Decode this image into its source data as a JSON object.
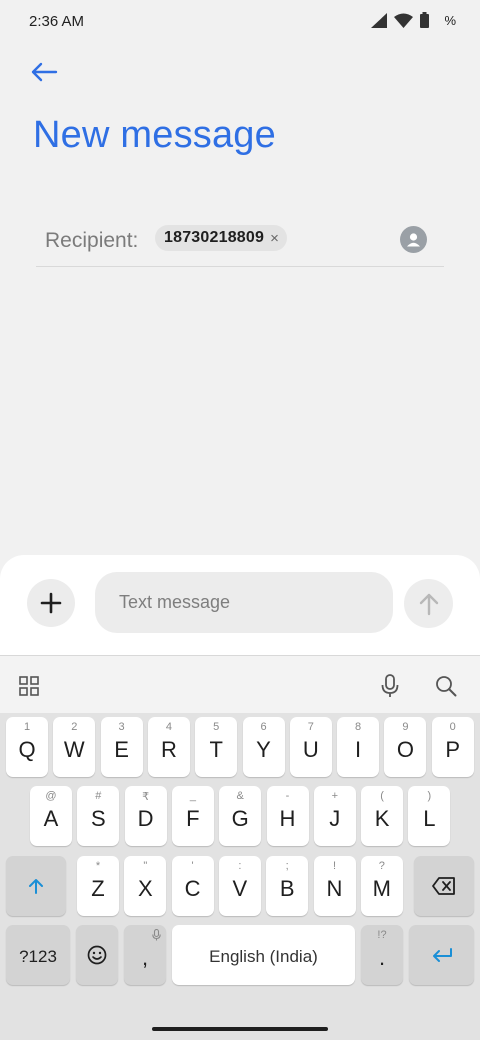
{
  "status_bar": {
    "time": "2:36 AM",
    "battery_text": "%"
  },
  "header": {
    "back_icon": "arrow-left-icon",
    "title": "New message"
  },
  "recipient": {
    "label": "Recipient:",
    "chip_number": "18730218809",
    "chip_remove": "×",
    "contact_icon": "person-icon"
  },
  "composer": {
    "placeholder": "Text message",
    "attach_icon": "plus-icon",
    "send_icon": "arrow-up-icon"
  },
  "keyboard": {
    "toolbar": {
      "apps_icon": "grid-icon",
      "mic_icon": "mic-icon",
      "search_icon": "search-icon"
    },
    "row1": [
      {
        "k": "Q",
        "h": "1"
      },
      {
        "k": "W",
        "h": "2"
      },
      {
        "k": "E",
        "h": "3"
      },
      {
        "k": "R",
        "h": "4"
      },
      {
        "k": "T",
        "h": "5"
      },
      {
        "k": "Y",
        "h": "6"
      },
      {
        "k": "U",
        "h": "7"
      },
      {
        "k": "I",
        "h": "8"
      },
      {
        "k": "O",
        "h": "9"
      },
      {
        "k": "P",
        "h": "0"
      }
    ],
    "row2": [
      {
        "k": "A",
        "h": "@"
      },
      {
        "k": "S",
        "h": "#"
      },
      {
        "k": "D",
        "h": "₹"
      },
      {
        "k": "F",
        "h": "_"
      },
      {
        "k": "G",
        "h": "&"
      },
      {
        "k": "H",
        "h": "-"
      },
      {
        "k": "J",
        "h": "+"
      },
      {
        "k": "K",
        "h": "("
      },
      {
        "k": "L",
        "h": ")"
      }
    ],
    "row3": [
      {
        "k": "Z",
        "h": "*"
      },
      {
        "k": "X",
        "h": "\""
      },
      {
        "k": "C",
        "h": "'"
      },
      {
        "k": "V",
        "h": ":"
      },
      {
        "k": "B",
        "h": ";"
      },
      {
        "k": "N",
        "h": "!"
      },
      {
        "k": "M",
        "h": "?"
      }
    ],
    "shift_icon": "shift-icon",
    "backspace_icon": "backspace-icon",
    "symbols_label": "?123",
    "emoji_icon": "emoji-icon",
    "comma": ",",
    "comma_hint_icon": "mic-icon",
    "space_label": "English (India)",
    "period": ".",
    "period_hint": "!?",
    "enter_icon": "enter-icon"
  },
  "colors": {
    "accent": "#2f6fe4",
    "key_accent": "#1a8fd6"
  }
}
